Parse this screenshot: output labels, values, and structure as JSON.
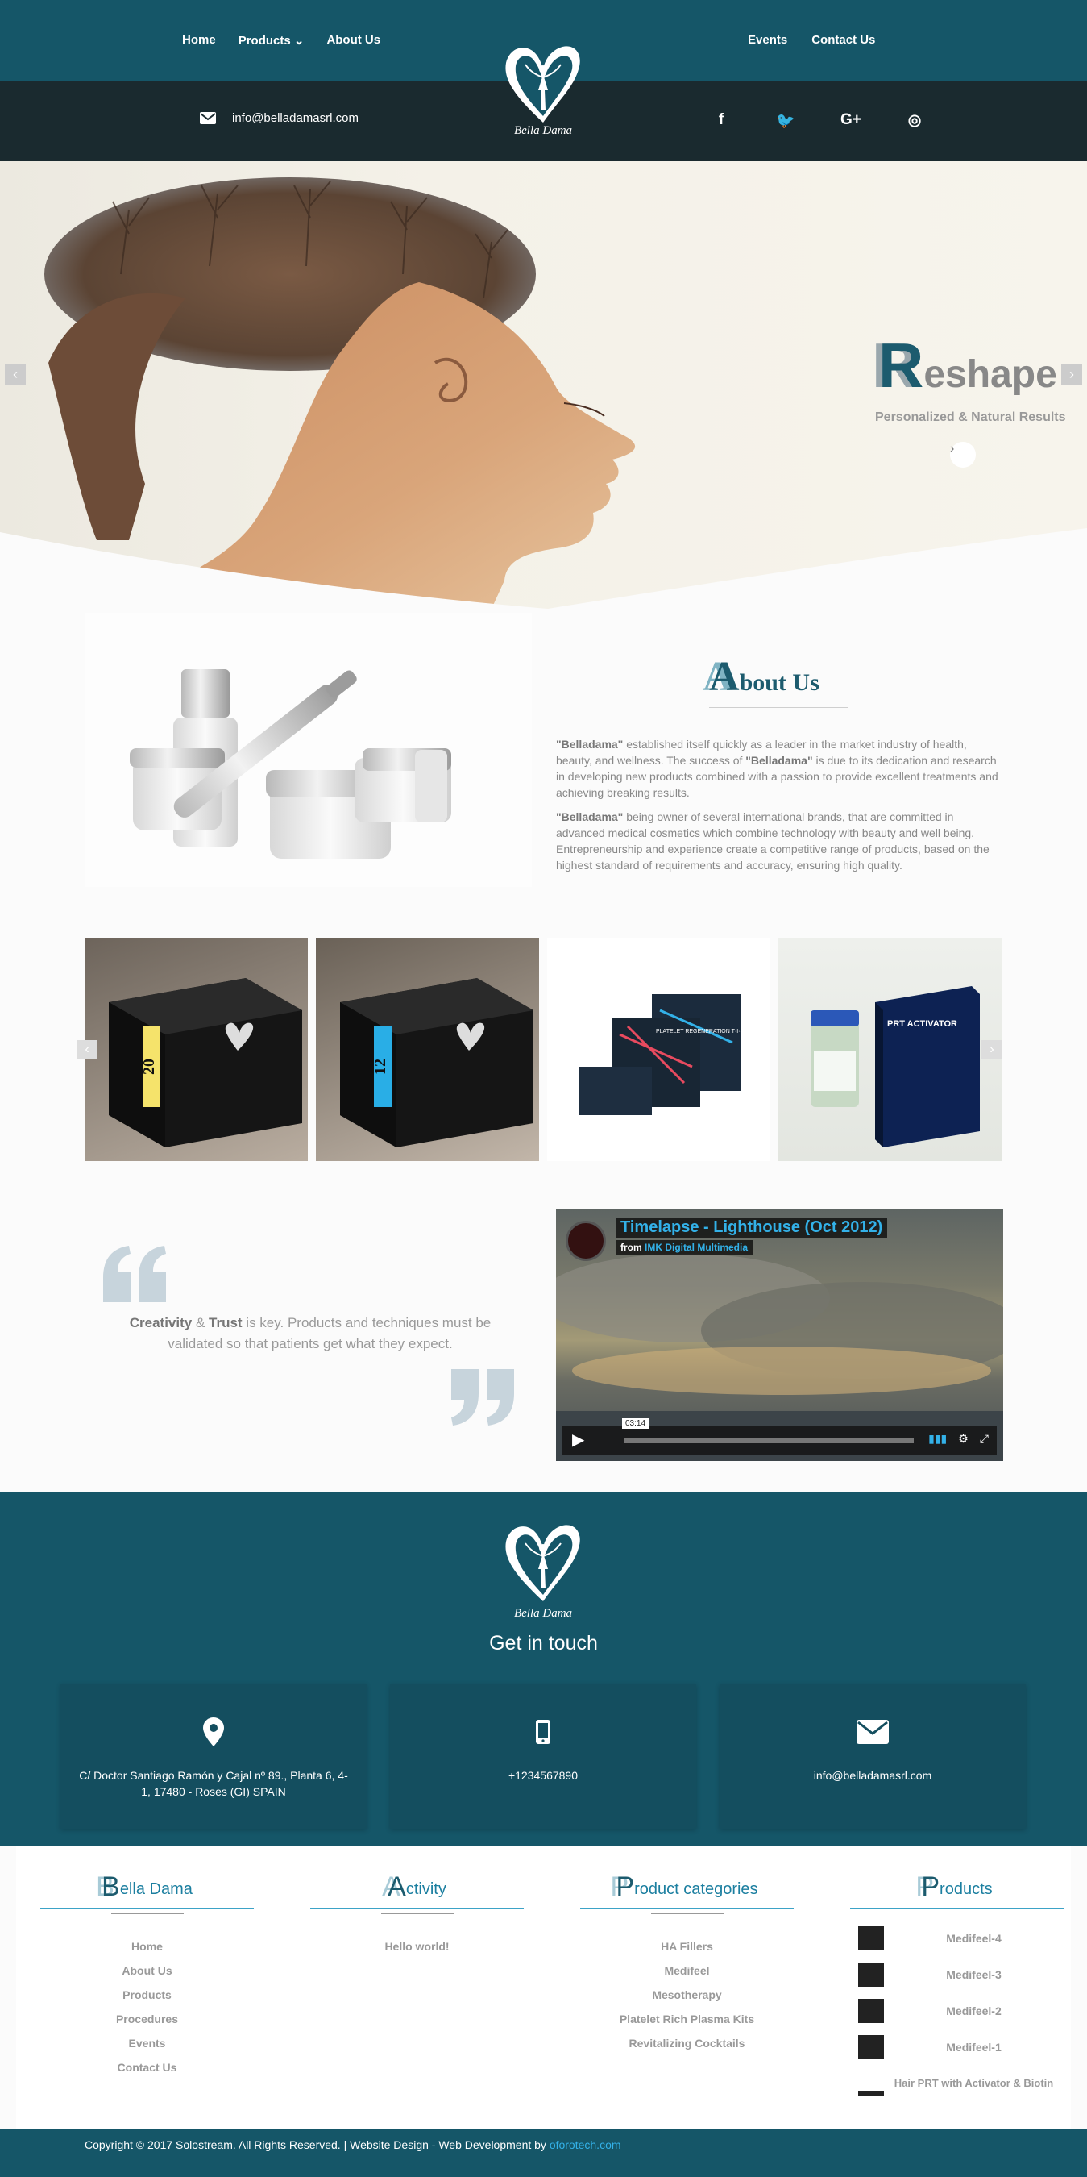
{
  "nav": {
    "left": [
      {
        "label": "Home"
      },
      {
        "label": "Products ⌄"
      },
      {
        "label": "About Us"
      }
    ],
    "right": [
      {
        "label": "Events"
      },
      {
        "label": "Contact Us"
      }
    ]
  },
  "topbar": {
    "email": "info@belladamasrl.com",
    "social": [
      "f",
      "🐦",
      "G+",
      "◎"
    ]
  },
  "brand": {
    "name": "Bella Dama"
  },
  "hero": {
    "title_cap": "R",
    "title_rest": "eshape",
    "subtitle": "Personalized & Natural Results"
  },
  "about": {
    "heading_cap": "A",
    "heading_rest": "bout Us",
    "p1_b1": "\"Belladama\"",
    "p1_t1": " established itself quickly as a leader in the market industry of health, beauty, and wellness. The success of ",
    "p1_b2": "\"Belladama\"",
    "p1_t2": " is due to its dedication and research in developing new products combined with a passion to provide excellent treatments and achieving breaking results.",
    "p2_b1": "\"Belladama\"",
    "p2_t1": " being owner of several international brands, that are committed in advanced medical cosmetics which combine technology with beauty and well being. Entrepreneurship and experience create a competitive range of products, based on the highest standard of requirements and accuracy, ensuring high quality."
  },
  "gallery": {
    "tiles": [
      {
        "label": "20"
      },
      {
        "label": "12"
      },
      {
        "label": "PLATELET REGENERATION T·I·S·S·U·E"
      },
      {
        "label": "PRT ACTIVATOR"
      }
    ]
  },
  "quote": {
    "b1": "Creativity",
    "t1": " & ",
    "b2": "Trust",
    "t2": " is key. Products and techniques must be validated so that patients get what they expect."
  },
  "video": {
    "title": "Timelapse - Lighthouse (Oct 2012)",
    "from_prefix": "from ",
    "from_author": "IMK Digital Multimedia",
    "time": "03:14"
  },
  "footer": {
    "get_in_touch": "Get in touch",
    "cards": [
      {
        "icon": "map-marker-icon",
        "text": "C/ Doctor Santiago Ramón y Cajal nº 89., Planta 6, 4-1, 17480 - Roses (GI) SPAIN"
      },
      {
        "icon": "phone-icon",
        "text": "+1234567890"
      },
      {
        "icon": "envelope-icon",
        "text": "info@belladamasrl.com"
      }
    ],
    "columns": {
      "bella": {
        "cap": "B",
        "rest": "ella Dama",
        "items": [
          "Home",
          "About Us",
          "Products",
          "Procedures",
          "Events",
          "Contact Us"
        ]
      },
      "activity": {
        "cap": "A",
        "rest": "ctivity",
        "items": [
          "Hello world!"
        ]
      },
      "categories": {
        "cap": "P",
        "rest": "roduct categories",
        "items": [
          "HA Fillers",
          "Medifeel",
          "Mesotherapy",
          "Platelet Rich Plasma Kits",
          "Revitalizing Cocktails"
        ]
      },
      "products": {
        "cap": "P",
        "rest": "roducts",
        "items": [
          "Medifeel-4",
          "Medifeel-3",
          "Medifeel-2",
          "Medifeel-1",
          "Hair PRT with Activator & Biotin"
        ]
      }
    },
    "copyright_text": "Copyright © 2017 Solostream. All Rights Reserved. | Website Design - Web Development by ",
    "copyright_link": "oforotech.com"
  },
  "colors": {
    "brand_dark": "#155668",
    "accent": "#1c5b6e",
    "link": "#33b1e8"
  }
}
